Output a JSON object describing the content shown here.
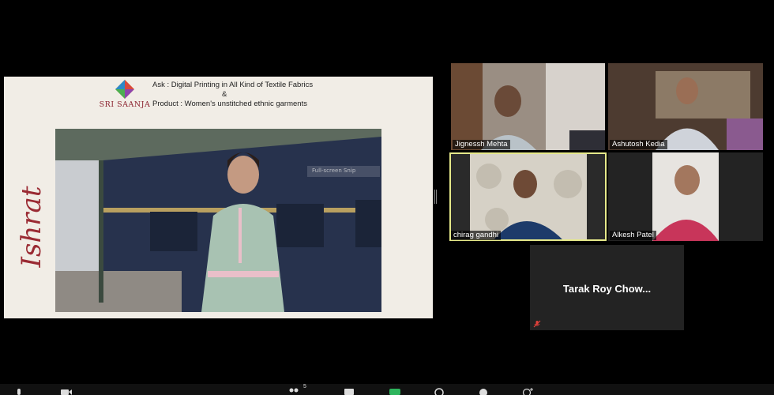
{
  "share": {
    "logo_text": "SRI SAANJA",
    "ask_line": "Ask : Digital Printing in All Kind of Textile Fabrics",
    "ampersand": "&",
    "product_line": "Product :  Women's unstitched ethnic garments",
    "script_name": "Ishrat",
    "pip_label": "Full-screen Snip"
  },
  "participants": [
    {
      "name": "Jignessh Mehta"
    },
    {
      "name": "Ashutosh Kedia"
    },
    {
      "name": "chirag gandhi"
    },
    {
      "name": "Alkesh Patel"
    },
    {
      "name": "Tarak Roy Chow..."
    }
  ],
  "toolbar": {
    "participant_count": "5"
  },
  "colors": {
    "active_speaker": "#e6e98a",
    "brand": "#8c2430"
  }
}
